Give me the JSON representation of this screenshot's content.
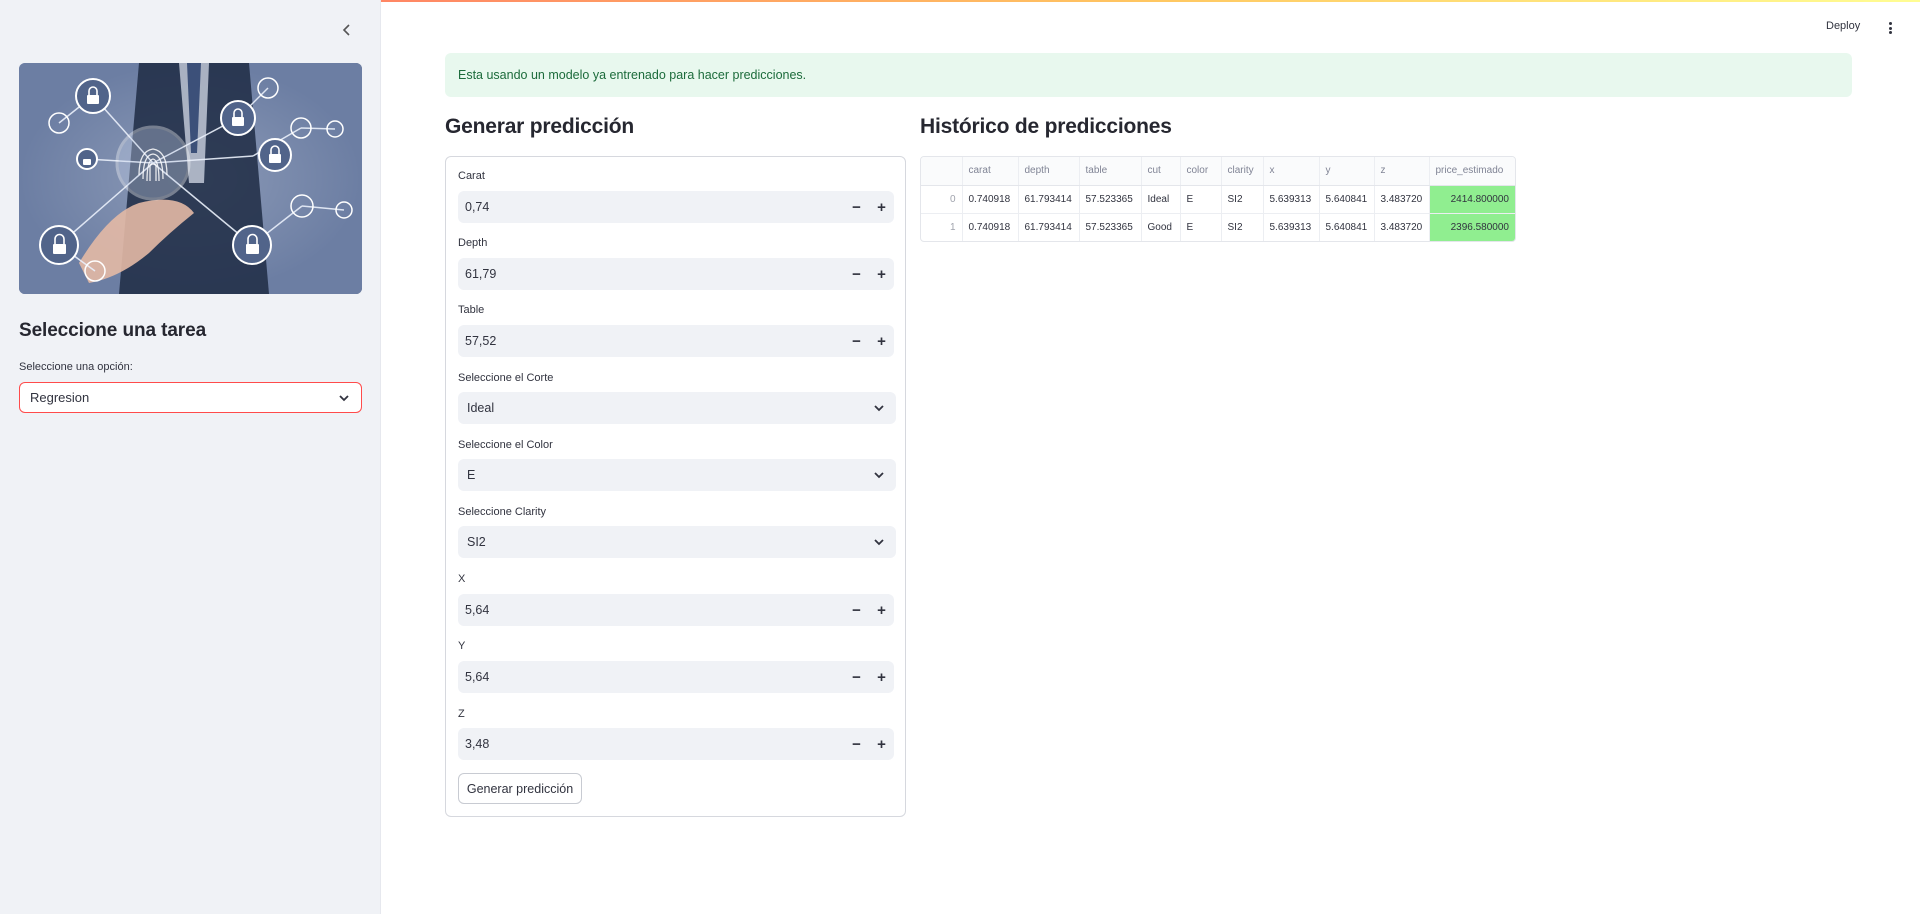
{
  "sidebar": {
    "heading": "Seleccione una tarea",
    "select_label": "Seleccione una opción:",
    "select_value": "Regresion",
    "hero_icon": "fingerprint-security-network-image"
  },
  "header": {
    "deploy_label": "Deploy"
  },
  "info_message": "Esta usando un modelo ya entrenado para hacer predicciones.",
  "form": {
    "title": "Generar predicción",
    "fields": {
      "carat": {
        "label": "Carat",
        "value": "0,74"
      },
      "depth": {
        "label": "Depth",
        "value": "61,79"
      },
      "table": {
        "label": "Table",
        "value": "57,52"
      },
      "corte": {
        "label": "Seleccione el Corte",
        "value": "Ideal"
      },
      "color": {
        "label": "Seleccione el Color",
        "value": "E"
      },
      "clarity": {
        "label": "Seleccione Clarity",
        "value": "SI2"
      },
      "x": {
        "label": "X",
        "value": "5,64"
      },
      "y": {
        "label": "Y",
        "value": "5,64"
      },
      "z": {
        "label": "Z",
        "value": "3,48"
      }
    },
    "submit_label": "Generar predicción"
  },
  "history": {
    "title": "Histórico de predicciones",
    "columns": [
      "",
      "carat",
      "depth",
      "table",
      "cut",
      "color",
      "clarity",
      "x",
      "y",
      "z",
      "price_estimado"
    ],
    "rows": [
      [
        "0",
        "0.740918",
        "61.793414",
        "57.523365",
        "Ideal",
        "E",
        "SI2",
        "5.639313",
        "5.640841",
        "3.483720",
        "2414.800000"
      ],
      [
        "1",
        "0.740918",
        "61.793414",
        "57.523365",
        "Good",
        "E",
        "SI2",
        "5.639313",
        "5.640841",
        "3.483720",
        "2396.580000"
      ]
    ],
    "highlight_color": "#90ee90"
  },
  "colors": {
    "accent": "#ff4b4b",
    "info_bg": "#e8f8ee",
    "info_text": "#1c6b3b",
    "sidebar_bg": "#f0f2f6"
  }
}
